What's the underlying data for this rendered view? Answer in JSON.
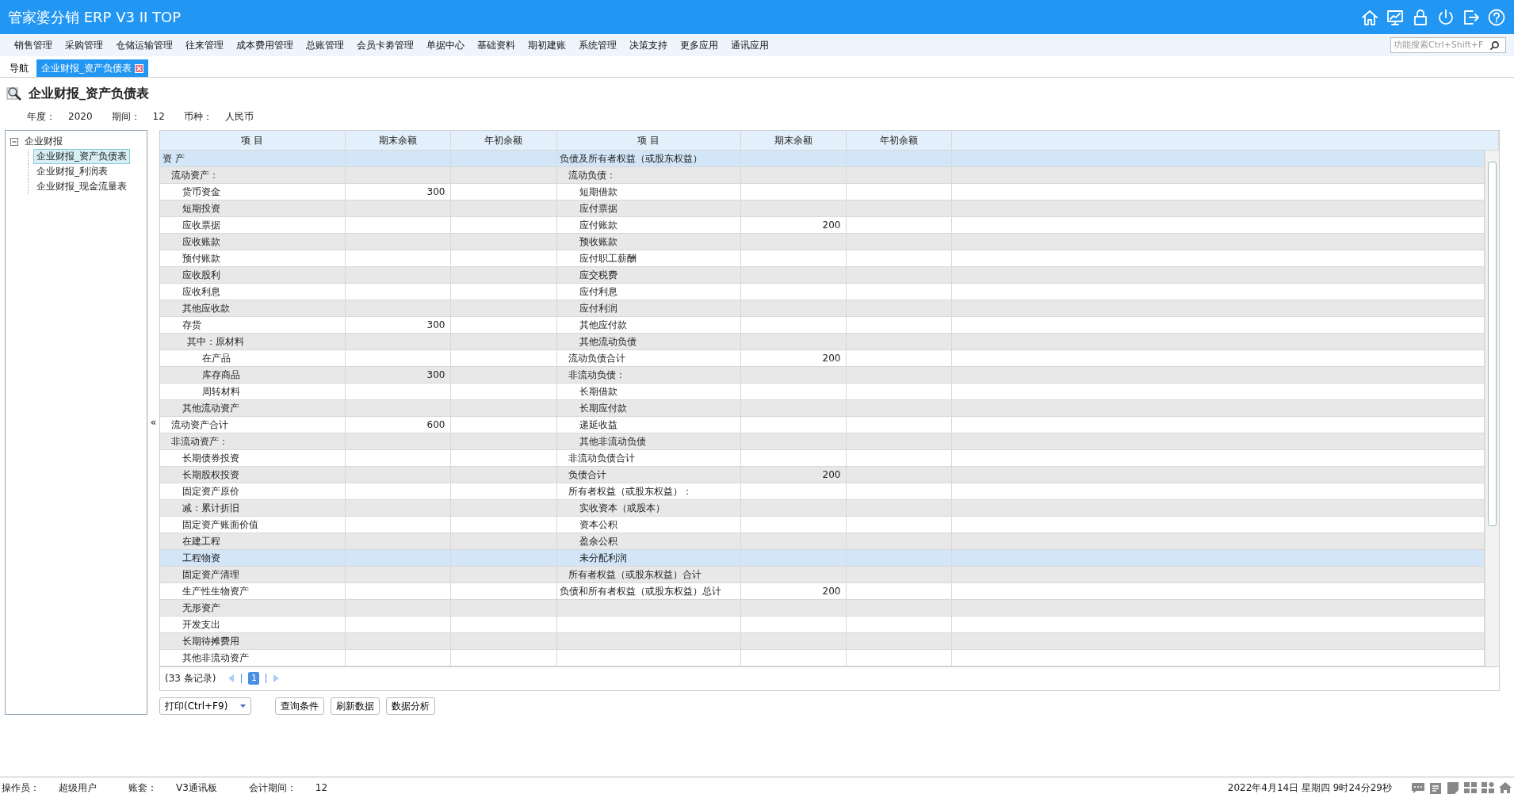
{
  "app": {
    "title": "管家婆分销 ERP V3 II TOP"
  },
  "menu": [
    "销售管理",
    "采购管理",
    "仓储运输管理",
    "往来管理",
    "成本费用管理",
    "总账管理",
    "会员卡劵管理",
    "单据中心",
    "基础资料",
    "期初建账",
    "系统管理",
    "决策支持",
    "更多应用",
    "通讯应用"
  ],
  "search": {
    "placeholder": "功能搜索Ctrl+Shift+F"
  },
  "tabs": [
    {
      "label": "导航",
      "selected": false
    },
    {
      "label": "企业财报_资产负债表",
      "selected": true
    }
  ],
  "page_title": "企业财报_资产负债表",
  "filters": [
    {
      "label": "年度：",
      "value": "2020"
    },
    {
      "label": "期间：",
      "value": "12"
    },
    {
      "label": "币种：",
      "value": "人民币"
    }
  ],
  "tree": {
    "label": "企业财报",
    "expanded": true,
    "children": [
      {
        "label": "企业财报_资产负债表",
        "selected": true
      },
      {
        "label": "企业财报_利润表",
        "selected": false
      },
      {
        "label": "企业财报_现金流量表",
        "selected": false
      }
    ]
  },
  "table": {
    "columns": [
      "项 目",
      "期末余额",
      "年初余额",
      "项 目",
      "期末余额",
      "年初余额"
    ],
    "rows": [
      {
        "left": {
          "text": "资 产",
          "kind": "section"
        },
        "right": {
          "text": "负债及所有者权益（或股东权益）",
          "kind": "section"
        },
        "selected": true
      },
      {
        "left": {
          "text": "流动资产：",
          "kind": "group"
        },
        "right": {
          "text": "流动负债：",
          "kind": "group"
        },
        "selected": false
      },
      {
        "left": {
          "text": "货币资金",
          "kind": "item"
        },
        "left_end": "300",
        "right": {
          "text": "短期借款",
          "kind": "item"
        },
        "selected": false
      },
      {
        "left": {
          "text": "短期投资",
          "kind": "item"
        },
        "right": {
          "text": "应付票据",
          "kind": "item"
        },
        "selected": false
      },
      {
        "left": {
          "text": "应收票据",
          "kind": "item"
        },
        "right": {
          "text": "应付账款",
          "kind": "item"
        },
        "right_end": "200",
        "selected": false
      },
      {
        "left": {
          "text": "应收账款",
          "kind": "item"
        },
        "right": {
          "text": "预收账款",
          "kind": "item"
        },
        "selected": false
      },
      {
        "left": {
          "text": "预付账款",
          "kind": "item"
        },
        "right": {
          "text": "应付职工薪酬",
          "kind": "item"
        },
        "selected": false
      },
      {
        "left": {
          "text": "应收股利",
          "kind": "item"
        },
        "right": {
          "text": "应交税费",
          "kind": "item"
        },
        "selected": false
      },
      {
        "left": {
          "text": "应收利息",
          "kind": "item"
        },
        "right": {
          "text": "应付利息",
          "kind": "item"
        },
        "selected": false
      },
      {
        "left": {
          "text": "其他应收款",
          "kind": "item"
        },
        "right": {
          "text": "应付利润",
          "kind": "item"
        },
        "selected": false
      },
      {
        "left": {
          "text": "存货",
          "kind": "item"
        },
        "left_end": "300",
        "right": {
          "text": "其他应付款",
          "kind": "item"
        },
        "selected": false
      },
      {
        "left": {
          "text": "其中：原材料",
          "kind": "note"
        },
        "right": {
          "text": "其他流动负债",
          "kind": "item"
        },
        "selected": false
      },
      {
        "left": {
          "text": "在产品",
          "kind": "sub"
        },
        "right": {
          "text": "流动负债合计",
          "kind": "group"
        },
        "right_end": "200",
        "selected": false
      },
      {
        "left": {
          "text": "库存商品",
          "kind": "sub"
        },
        "left_end": "300",
        "right": {
          "text": "非流动负债：",
          "kind": "group"
        },
        "selected": false
      },
      {
        "left": {
          "text": "周转材料",
          "kind": "sub"
        },
        "right": {
          "text": "长期借款",
          "kind": "item"
        },
        "selected": false
      },
      {
        "left": {
          "text": "其他流动资产",
          "kind": "item"
        },
        "right": {
          "text": "长期应付款",
          "kind": "item"
        },
        "selected": false
      },
      {
        "left": {
          "text": "流动资产合计",
          "kind": "group"
        },
        "left_end": "600",
        "right": {
          "text": "递延收益",
          "kind": "item"
        },
        "selected": false
      },
      {
        "left": {
          "text": "非流动资产：",
          "kind": "group"
        },
        "right": {
          "text": "其他非流动负债",
          "kind": "item"
        },
        "selected": false
      },
      {
        "left": {
          "text": "长期债券投资",
          "kind": "item"
        },
        "right": {
          "text": "非流动负债合计",
          "kind": "group"
        },
        "selected": false
      },
      {
        "left": {
          "text": "长期股权投资",
          "kind": "item"
        },
        "right": {
          "text": "负债合计",
          "kind": "group"
        },
        "right_end": "200",
        "selected": false
      },
      {
        "left": {
          "text": "固定资产原价",
          "kind": "item"
        },
        "right": {
          "text": "所有者权益（或股东权益）：",
          "kind": "group"
        },
        "selected": false
      },
      {
        "left": {
          "text": "减：累计折旧",
          "kind": "item"
        },
        "right": {
          "text": "实收资本（或股本）",
          "kind": "item"
        },
        "selected": false
      },
      {
        "left": {
          "text": "固定资产账面价值",
          "kind": "item"
        },
        "right": {
          "text": "资本公积",
          "kind": "item"
        },
        "selected": false
      },
      {
        "left": {
          "text": "在建工程",
          "kind": "item"
        },
        "right": {
          "text": "盈余公积",
          "kind": "item"
        },
        "selected": false
      },
      {
        "left": {
          "text": "工程物资",
          "kind": "item"
        },
        "right": {
          "text": "未分配利润",
          "kind": "item"
        },
        "selected": true
      },
      {
        "left": {
          "text": "固定资产清理",
          "kind": "item"
        },
        "right": {
          "text": "所有者权益（或股东权益）合计",
          "kind": "group"
        },
        "selected": false
      },
      {
        "left": {
          "text": "生产性生物资产",
          "kind": "item"
        },
        "right": {
          "text": "负债和所有者权益（或股东权益）总计",
          "kind": "section"
        },
        "right_end": "200",
        "selected": false
      },
      {
        "left": {
          "text": "无形资产",
          "kind": "item"
        },
        "selected": false
      },
      {
        "left": {
          "text": "开发支出",
          "kind": "item"
        },
        "selected": false
      },
      {
        "left": {
          "text": "长期待摊费用",
          "kind": "item"
        },
        "selected": false
      },
      {
        "left": {
          "text": "其他非流动资产",
          "kind": "item"
        },
        "selected": false
      }
    ]
  },
  "collapse_toggle": "«",
  "pager": {
    "summary": "(33 条记录)",
    "pages": [
      {
        "label": "1",
        "selected": true
      }
    ]
  },
  "buttons": [
    {
      "label": "打印(Ctrl+F9)",
      "kind": "dropdown"
    },
    {
      "label": "查询条件",
      "kind": "plain"
    },
    {
      "label": "刷新数据",
      "kind": "plain"
    },
    {
      "label": "数据分析",
      "kind": "plain"
    }
  ],
  "status_bar": {
    "fields": [
      {
        "label": "操作员：",
        "value": "超级用户"
      },
      {
        "label": "账套：",
        "value": "V3通讯板"
      },
      {
        "label": "会计期间：",
        "value": "12"
      }
    ],
    "datetime": "2022年4月14日 星期四 9时24分29秒"
  }
}
